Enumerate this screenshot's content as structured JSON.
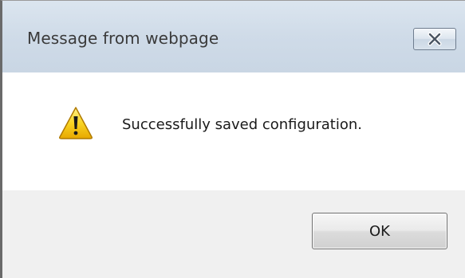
{
  "dialog": {
    "title": "Message from webpage",
    "message": "Successfully saved configuration.",
    "ok_label": "OK",
    "close_icon": "close-x-icon",
    "message_icon": "warning-icon"
  },
  "colors": {
    "titlebar": "#cfdbe8",
    "content_bg": "#ffffff",
    "footer_bg": "#f0f0f0",
    "warning_fill": "#f6c700"
  }
}
